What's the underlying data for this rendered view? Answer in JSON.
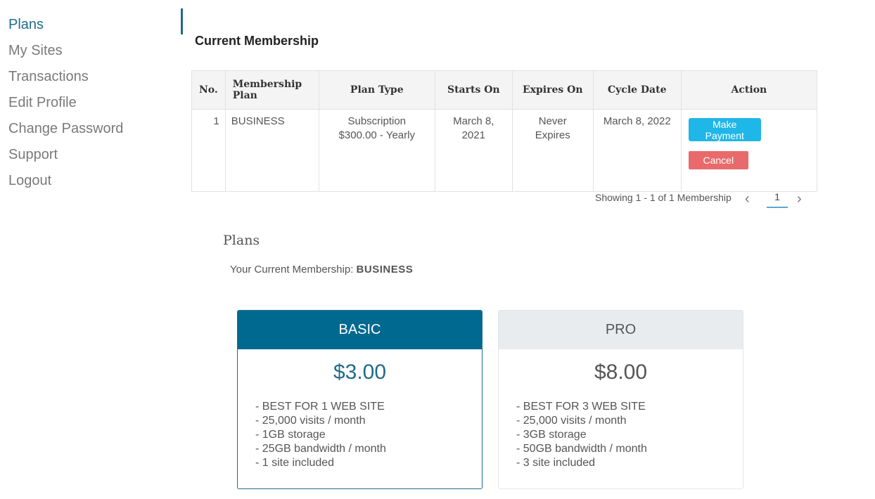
{
  "sidebar": {
    "items": [
      {
        "label": "Plans"
      },
      {
        "label": "My Sites"
      },
      {
        "label": "Transactions"
      },
      {
        "label": "Edit Profile"
      },
      {
        "label": "Change Password"
      },
      {
        "label": "Support"
      },
      {
        "label": "Logout"
      }
    ]
  },
  "current_membership": {
    "title": "Current Membership",
    "columns": [
      "No.",
      "Membership Plan",
      "Plan Type",
      "Starts On",
      "Expires On",
      "Cycle Date",
      "Action"
    ],
    "row": {
      "no": "1",
      "plan": "BUSINESS",
      "type_line1": "Subscription",
      "type_line2": "$300.00 - Yearly",
      "starts_line1": "March 8,",
      "starts_line2": "2021",
      "expires_line1": "Never",
      "expires_line2": "Expires",
      "cycle": "March 8, 2022",
      "pay_label": "Make Payment",
      "cancel_label": "Cancel"
    },
    "pager": {
      "text": "Showing 1 - 1 of 1 Membership",
      "page": "1",
      "prev_icon": "chevron-left",
      "next_icon": "chevron-right"
    }
  },
  "plans": {
    "title": "Plans",
    "current_label": "Your Current Membership:",
    "current_value": "BUSINESS",
    "cards": [
      {
        "name": "BASIC",
        "price": "$3.00",
        "features": [
          "- BEST FOR 1 WEB SITE",
          "- 25,000 visits / month",
          "- 1GB storage",
          "- 25GB bandwidth / month",
          "- 1 site included"
        ]
      },
      {
        "name": "PRO",
        "price": "$8.00",
        "features": [
          "- BEST FOR 3 WEB SITE",
          "- 25,000 visits / month",
          "- 3GB storage",
          "- 50GB bandwidth / month",
          "- 3 site included"
        ]
      }
    ]
  },
  "colors": {
    "accent": "#00698f",
    "pay_button": "#1fb6e8",
    "cancel_button": "#e86a6a"
  }
}
